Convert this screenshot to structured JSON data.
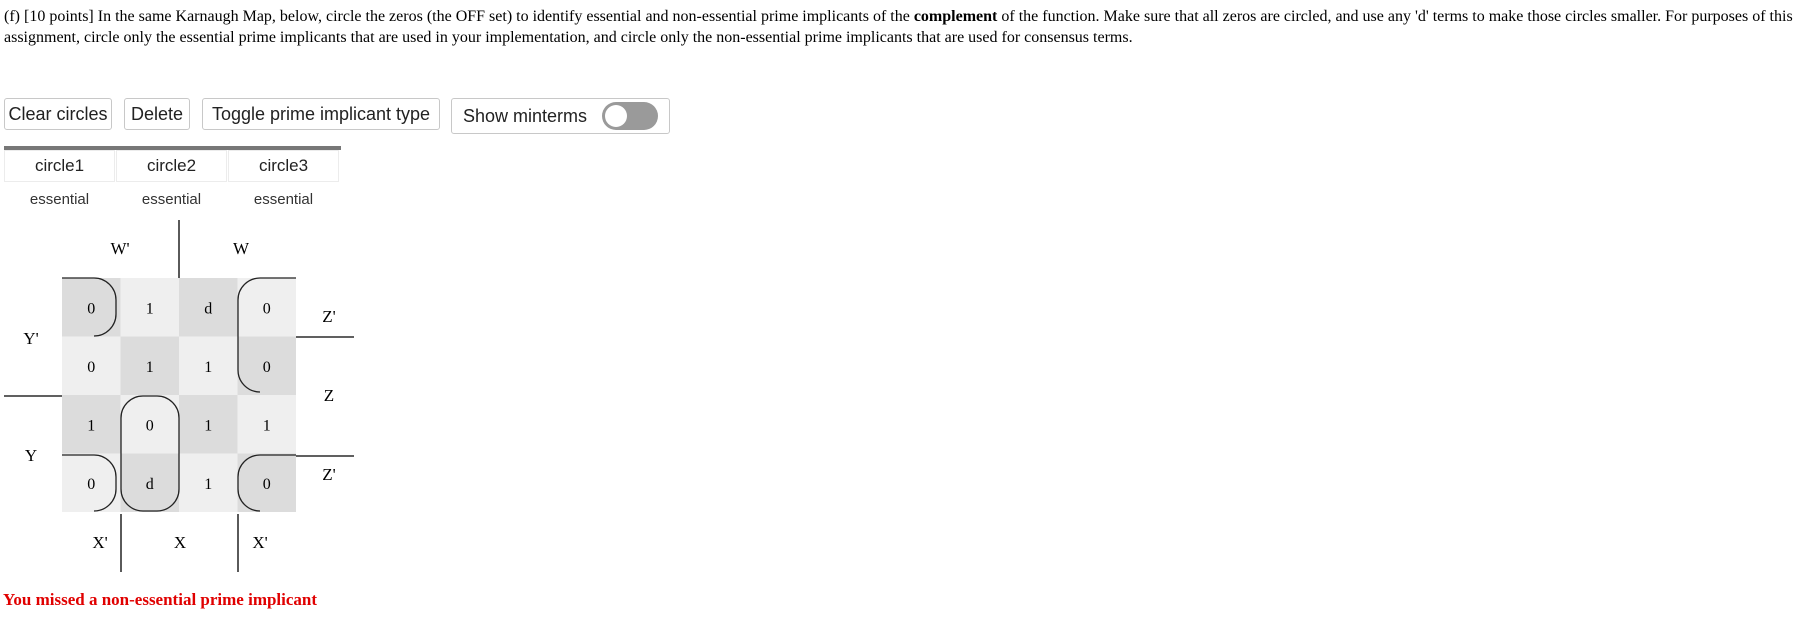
{
  "question": {
    "prefix": "(f) [10 points] In the same Karnaugh Map, below, circle the zeros (the OFF set) to identify essential and non-essential prime implicants of the ",
    "bold": "complement",
    "suffix": " of the function. Make sure that all zeros are circled, and use any 'd' terms to make those circles smaller. For purposes of this assignment, circle only the essential prime implicants that are used in your implementation, and circle only the non-essential prime implicants that are used for consensus terms."
  },
  "toolbar": {
    "clear_label": "Clear circles",
    "delete_label": "Delete",
    "toggle_type_label": "Toggle prime implicant type",
    "show_minterms_label": "Show minterms",
    "show_minterms_on": false
  },
  "circles": [
    {
      "name": "circle1",
      "type": "essential"
    },
    {
      "name": "circle2",
      "type": "essential"
    },
    {
      "name": "circle3",
      "type": "essential"
    }
  ],
  "kmap": {
    "labels": {
      "w_bar": "W'",
      "w": "W",
      "y_bar": "Y'",
      "y": "Y",
      "z_bar_top": "Z'",
      "z": "Z",
      "z_bar_bottom": "Z'",
      "x_bar_left": "X'",
      "x": "X",
      "x_bar_right": "X'"
    },
    "cells": [
      [
        "0",
        "1",
        "d",
        "0"
      ],
      [
        "0",
        "1",
        "1",
        "0"
      ],
      [
        "1",
        "0",
        "1",
        "1"
      ],
      [
        "0",
        "d",
        "1",
        "0"
      ]
    ],
    "colors": {
      "dark": "#dcdcdc",
      "light": "#efefef",
      "grid": "#000000"
    }
  },
  "feedback": "You missed a non-essential prime implicant"
}
